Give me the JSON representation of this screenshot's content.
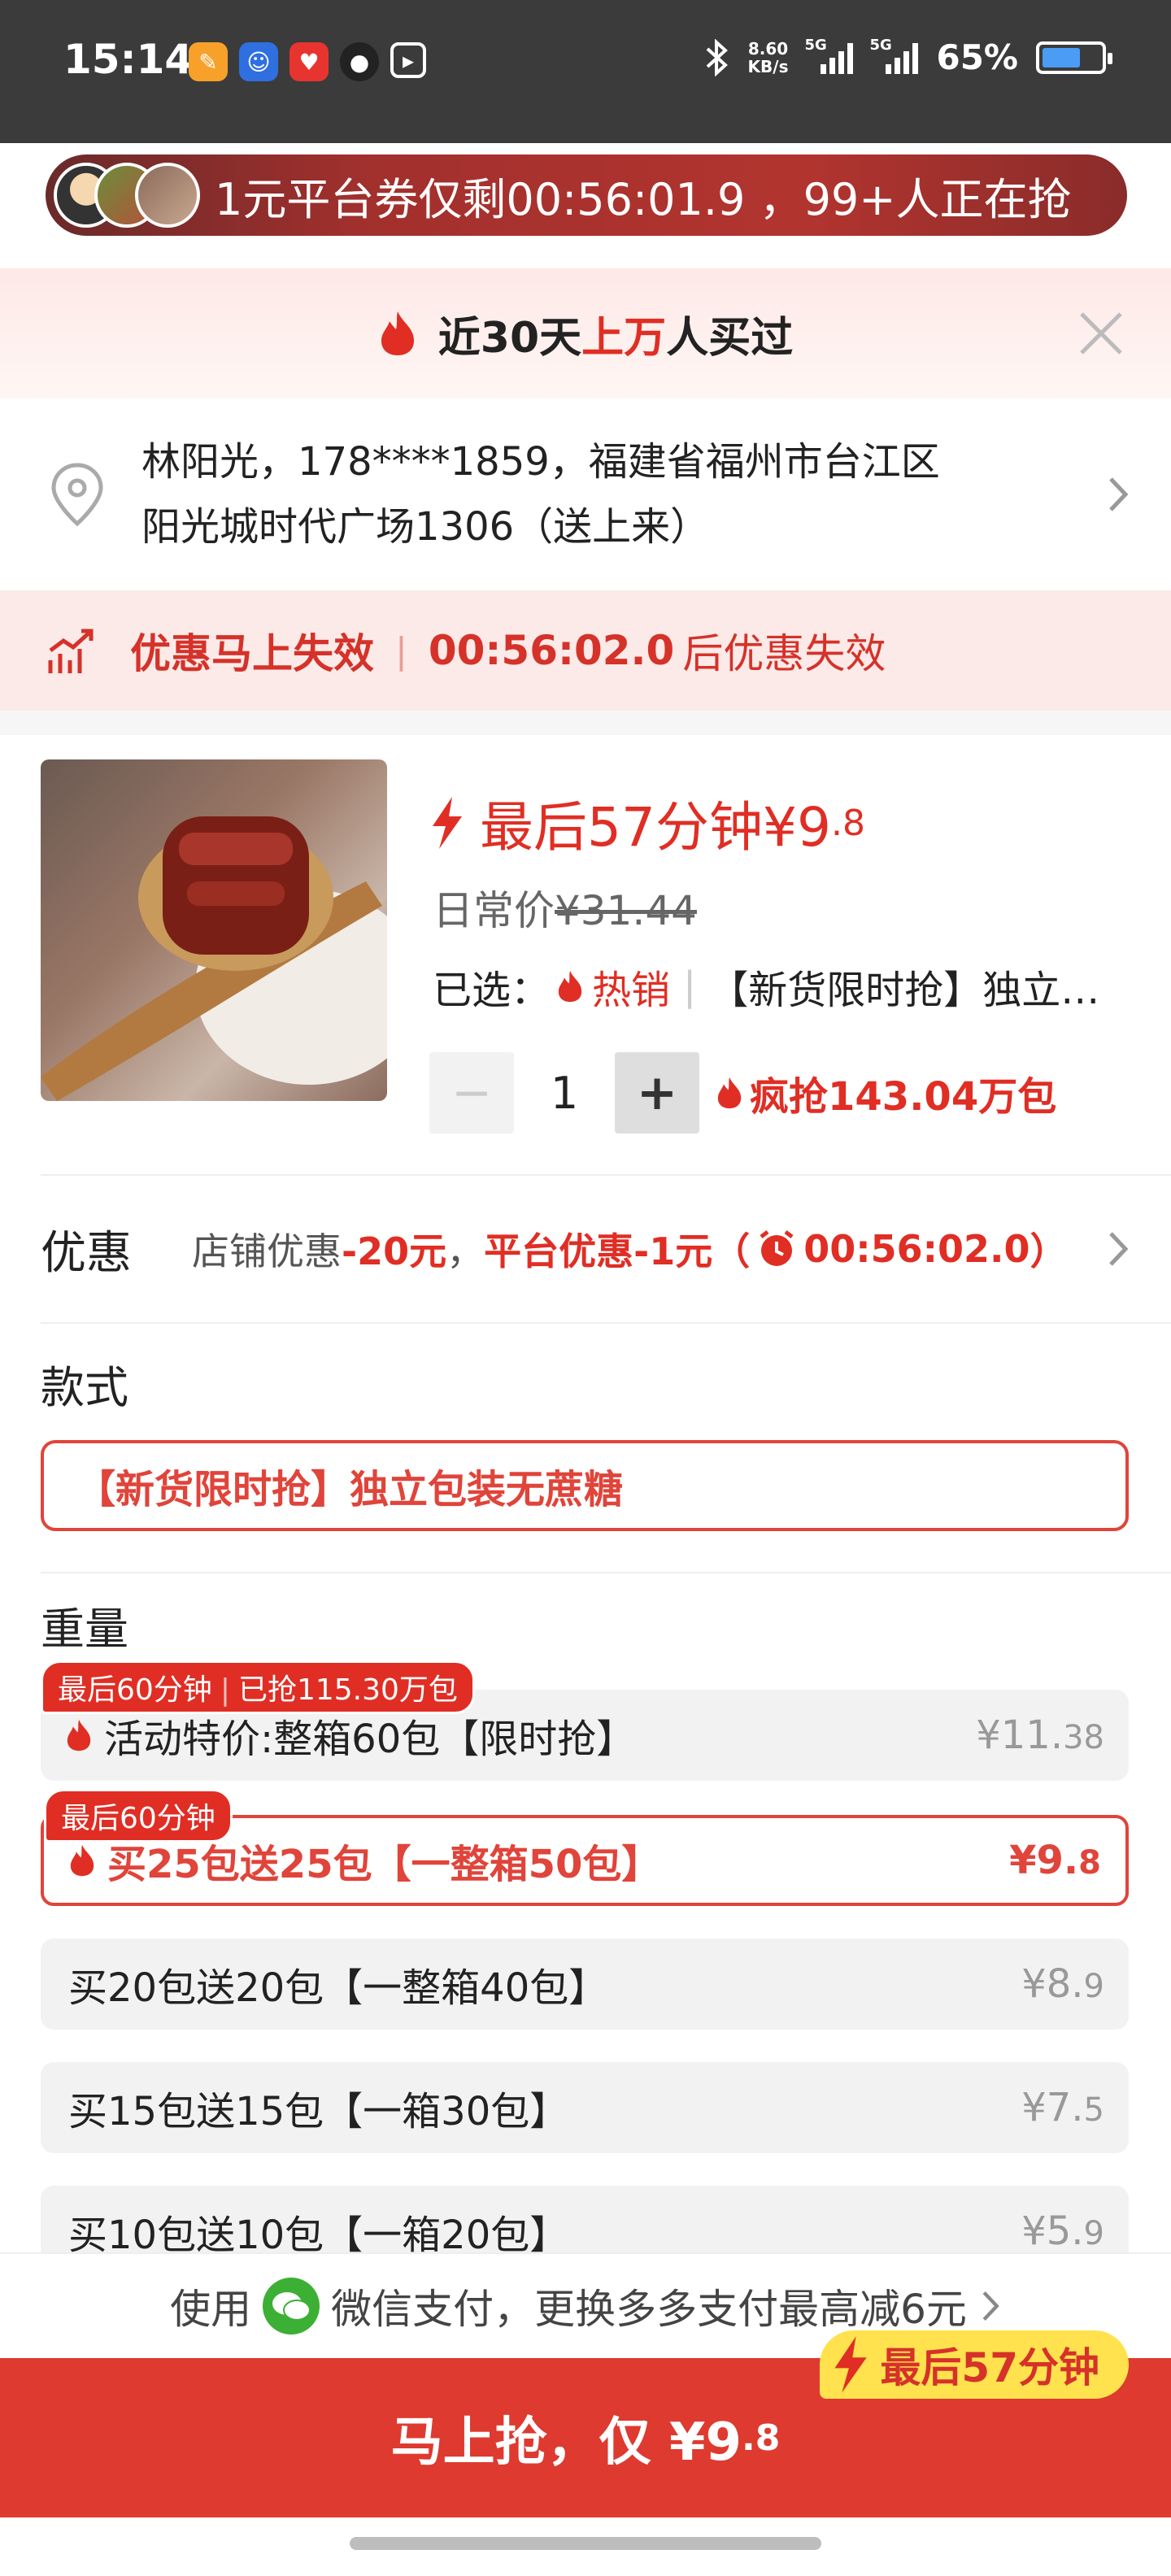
{
  "status_bar": {
    "time": "15:14",
    "net_speed_value": "8.60",
    "net_speed_unit": "KB/s",
    "signal_label_1": "5G",
    "signal_label_2": "5G",
    "battery": "65%",
    "battery_level": 0.65,
    "app_icons": [
      "orange-app-icon",
      "blue-app-icon",
      "red-heart-app-icon",
      "dark-app-icon",
      "screen-record-icon"
    ],
    "icons": [
      "bluetooth-icon",
      "signal-icon",
      "signal-icon",
      "battery-icon"
    ]
  },
  "banner": {
    "text": "1元平台券仅剩00:56:01.9 ，99+人正在抢"
  },
  "buyers": {
    "prefix": "近30天",
    "highlight": "上万",
    "suffix": "人买过"
  },
  "address": {
    "line1": "林阳光，178****1859，福建省福州市台江区",
    "line2": "阳光城时代广场1306（送上来）"
  },
  "expire": {
    "label": "优惠马上失效",
    "separator": "|",
    "timer": "00:56:02.0",
    "tail": "后优惠失效"
  },
  "product": {
    "flash_label": "最后57分钟¥9",
    "flash_decimal": ".8",
    "orig_label": "日常价",
    "orig_price": "¥31.44",
    "chosen_label": "已选：",
    "chosen_hot": "热销",
    "chosen_separator": "|",
    "chosen_option": "【新货限时抢】独立…",
    "minus": "−",
    "quantity": "1",
    "plus": "+",
    "sales": "疯抢143.04万包"
  },
  "discount": {
    "label": "优惠",
    "shop": "店铺优惠",
    "shop_value": "-20元",
    "comma": "，",
    "platform": "平台优惠-1元（",
    "timer": "00:56:02.0",
    "close_paren": "）"
  },
  "style": {
    "title": "款式",
    "selected": "【新货限时抢】独立包装无蔗糖"
  },
  "weight": {
    "title": "重量",
    "options": [
      {
        "name": "活动特价:整箱60包【限时抢】",
        "price": "¥11.",
        "price_decimal": "38",
        "tag": "最后60分钟",
        "tag_extra": "已抢115.30万包",
        "hot": true,
        "selected": false
      },
      {
        "name": "买25包送25包【一整箱50包】",
        "price": "¥9.",
        "price_decimal": "8",
        "tag": "最后60分钟",
        "hot": true,
        "selected": true
      },
      {
        "name": "买20包送20包【一整箱40包】",
        "price": "¥8.",
        "price_decimal": "9",
        "selected": false
      },
      {
        "name": "买15包送15包【一箱30包】",
        "price": "¥7.",
        "price_decimal": "5",
        "selected": false
      },
      {
        "name": "买10包送10包【一箱20包】",
        "price": "¥5.",
        "price_decimal": "9",
        "selected": false
      }
    ]
  },
  "pay": {
    "prefix": "使用",
    "method": "微信支付，更换多多支付最高减6元"
  },
  "buy": {
    "label": "马上抢，仅 ¥9",
    "decimal": ".8",
    "badge": "最后57分钟"
  },
  "colors": {
    "accent": "#e02e24",
    "button": "#de3a2f",
    "badge": "#ffe24d",
    "statusbar": "#3b3b3b"
  }
}
